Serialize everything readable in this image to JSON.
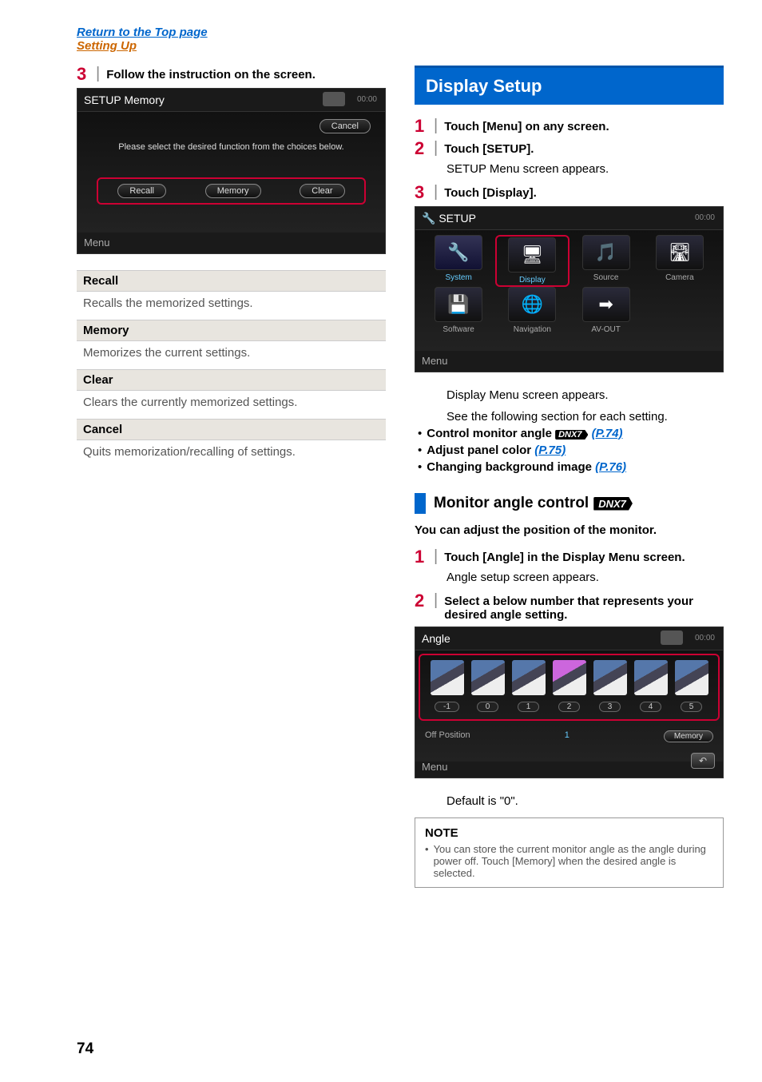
{
  "header": {
    "top_link": "Return to the Top page",
    "section_link": "Setting Up"
  },
  "left": {
    "step3": "Follow the instruction on the screen.",
    "ss": {
      "title": "SETUP Memory",
      "time": "00:00",
      "cancel": "Cancel",
      "prompt": "Please select the desired function from the choices below.",
      "recall": "Recall",
      "memory": "Memory",
      "clear": "Clear",
      "menu": "Menu"
    },
    "labels": {
      "recall": "Recall",
      "recall_desc": "Recalls the memorized settings.",
      "memory": "Memory",
      "memory_desc": "Memorizes the current settings.",
      "clear": "Clear",
      "clear_desc": "Clears the currently memorized settings.",
      "cancel": "Cancel",
      "cancel_desc": "Quits memorization/recalling of settings."
    }
  },
  "right": {
    "title": "Display Setup",
    "step1": "Touch [Menu] on any screen.",
    "step2": "Touch [SETUP].",
    "step2_sub": "SETUP Menu screen appears.",
    "step3": "Touch [Display].",
    "ss_setup": {
      "title": "SETUP",
      "time": "00:00",
      "system": "System",
      "display": "Display",
      "source": "Source",
      "camera": "Camera",
      "software": "Software",
      "navigation": "Navigation",
      "avout": "AV-OUT",
      "menu": "Menu"
    },
    "after_setup1": "Display Menu screen appears.",
    "after_setup2": "See the following section for each setting.",
    "bullet1": "Control monitor angle",
    "bullet1_link": "(P.74)",
    "bullet2": "Adjust panel color",
    "bullet2_link": "(P.75)",
    "bullet3": "Changing background image",
    "bullet3_link": "(P.76)",
    "dnx7": "DNX7",
    "subsection": "Monitor angle control",
    "intro": "You can adjust the position of the monitor.",
    "mstep1": "Touch [Angle] in the Display Menu screen.",
    "mstep1_sub": "Angle setup screen appears.",
    "mstep2": "Select a below number that represents your desired angle setting.",
    "ss_angle": {
      "title": "Angle",
      "time": "00:00",
      "nums": [
        "-1",
        "0",
        "1",
        "2",
        "3",
        "4",
        "5"
      ],
      "off_position": "Off Position",
      "off_val": "1",
      "memory": "Memory",
      "menu": "Menu"
    },
    "default": "Default is \"0\".",
    "note_title": "NOTE",
    "note_text": "You can store the current monitor angle as the angle during power off. Touch [Memory] when the desired angle is selected."
  },
  "page": "74"
}
